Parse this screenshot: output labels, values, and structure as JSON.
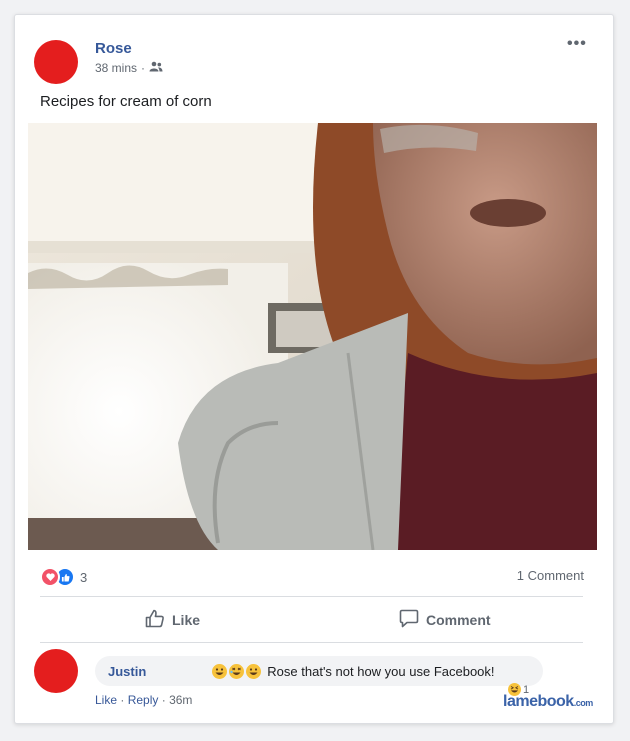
{
  "post": {
    "author": "Rose",
    "time": "38 mins",
    "separator": "·",
    "audience_icon": "friends-icon",
    "more_label": "•••",
    "text": "Recipes for cream of corn"
  },
  "stats": {
    "reaction_icons": [
      "love-reaction-icon",
      "like-reaction-icon"
    ],
    "reaction_count": "3",
    "comments_count": "1 Comment"
  },
  "actions": {
    "like_label": "Like",
    "comment_label": "Comment"
  },
  "comment": {
    "author": "Justin",
    "emojis": [
      "grinning-face-icon",
      "rofl-face-icon",
      "grinning-face-icon"
    ],
    "text": "Rose that's not how you use Facebook!",
    "like_label": "Like",
    "reply_label": "Reply",
    "separator": "·",
    "time": "36m",
    "reaction_icon": "haha-reaction-icon",
    "reaction_count": "1"
  },
  "watermark": {
    "brand": "lamebook",
    "tld": ".com"
  },
  "colors": {
    "avatar": "#e41e1e",
    "link": "#365899",
    "like_blue": "#1877f2",
    "love_red": "#f25268",
    "watermark": "#3b63a8"
  }
}
